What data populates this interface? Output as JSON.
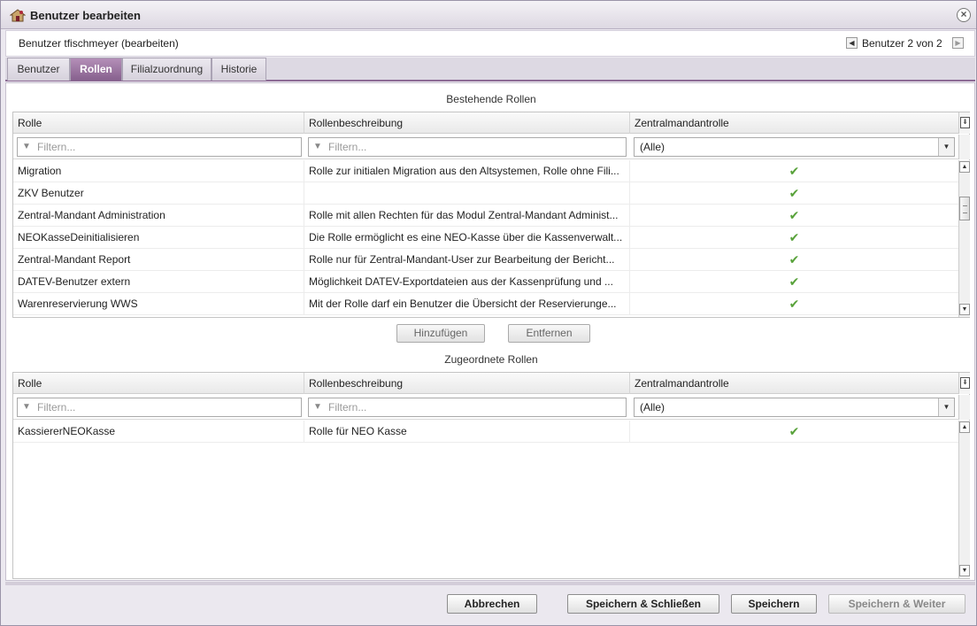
{
  "window": {
    "title": "Benutzer bearbeiten"
  },
  "subheader": {
    "title": "Benutzer tfischmeyer (bearbeiten)",
    "nav_label": "Benutzer 2 von 2"
  },
  "tabs": [
    {
      "label": "Benutzer"
    },
    {
      "label": "Rollen"
    },
    {
      "label": "Filialzuordnung"
    },
    {
      "label": "Historie"
    }
  ],
  "existing": {
    "title": "Bestehende Rollen",
    "columns": [
      "Rolle",
      "Rollenbeschreibung",
      "Zentralmandantrolle"
    ],
    "filter_placeholder": "Filtern...",
    "select_value": "(Alle)",
    "rows": [
      {
        "rolle": "Migration",
        "beschreibung": "Rolle zur initialen Migration aus den Altsystemen, Rolle ohne Fili...",
        "zentral": "✔"
      },
      {
        "rolle": "ZKV Benutzer",
        "beschreibung": "",
        "zentral": "✔"
      },
      {
        "rolle": "Zentral-Mandant Administration",
        "beschreibung": "Rolle mit allen Rechten für das Modul Zentral-Mandant Administ...",
        "zentral": "✔"
      },
      {
        "rolle": "NEOKasseDeinitialisieren",
        "beschreibung": "Die Rolle ermöglicht es eine NEO-Kasse über die Kassenverwalt...",
        "zentral": "✔"
      },
      {
        "rolle": "Zentral-Mandant Report",
        "beschreibung": "Rolle nur für Zentral-Mandant-User zur Bearbeitung der Bericht...",
        "zentral": "✔"
      },
      {
        "rolle": "DATEV-Benutzer extern",
        "beschreibung": "Möglichkeit DATEV-Exportdateien aus der Kassenprüfung und ...",
        "zentral": "✔"
      },
      {
        "rolle": "Warenreservierung WWS",
        "beschreibung": "Mit der Rolle darf ein Benutzer die Übersicht der Reservierunge...",
        "zentral": "✔"
      }
    ]
  },
  "actions": {
    "add_label": "Hinzufügen",
    "remove_label": "Entfernen"
  },
  "assigned": {
    "title": "Zugeordnete Rollen",
    "columns": [
      "Rolle",
      "Rollenbeschreibung",
      "Zentralmandantrolle"
    ],
    "filter_placeholder": "Filtern...",
    "select_value": "(Alle)",
    "rows": [
      {
        "rolle": "KassiererNEOKasse",
        "beschreibung": "Rolle für NEO Kasse",
        "zentral": "✔"
      }
    ]
  },
  "footer": {
    "cancel_label": "Abbrechen",
    "save_close_label": "Speichern & Schließen",
    "save_label": "Speichern",
    "save_next_label": "Speichern & Weiter"
  }
}
